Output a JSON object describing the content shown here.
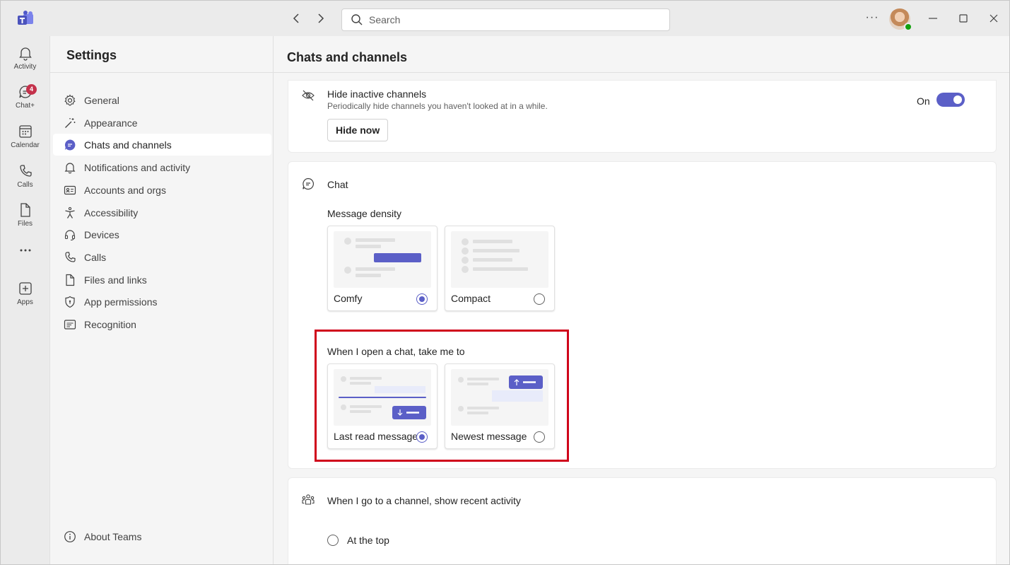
{
  "titlebar": {
    "search_placeholder": "Search",
    "more_label": "···"
  },
  "rail": {
    "items": [
      {
        "label": "Activity",
        "icon": "bell-icon"
      },
      {
        "label": "Chat+",
        "icon": "chat-icon",
        "badge": "4"
      },
      {
        "label": "Calendar",
        "icon": "calendar-icon"
      },
      {
        "label": "Calls",
        "icon": "phone-icon"
      },
      {
        "label": "Files",
        "icon": "file-icon"
      },
      {
        "label": "...",
        "icon": "more-icon"
      },
      {
        "label": "Apps",
        "icon": "add-app-icon"
      }
    ]
  },
  "settings": {
    "title": "Settings",
    "nav": [
      {
        "label": "General",
        "icon": "gear-icon"
      },
      {
        "label": "Appearance",
        "icon": "magic-wand-icon"
      },
      {
        "label": "Chats and channels",
        "icon": "chat-bubble-icon",
        "active": true
      },
      {
        "label": "Notifications and activity",
        "icon": "bell-icon"
      },
      {
        "label": "Accounts and orgs",
        "icon": "contact-card-icon"
      },
      {
        "label": "Accessibility",
        "icon": "accessibility-icon"
      },
      {
        "label": "Devices",
        "icon": "headset-icon"
      },
      {
        "label": "Calls",
        "icon": "phone-icon"
      },
      {
        "label": "Files and links",
        "icon": "document-icon"
      },
      {
        "label": "App permissions",
        "icon": "shield-icon"
      },
      {
        "label": "Recognition",
        "icon": "text-box-icon"
      }
    ],
    "about_label": "About Teams"
  },
  "main": {
    "title": "Chats and channels",
    "hide_inactive": {
      "title": "Hide inactive channels",
      "subtitle": "Periodically hide channels you haven't looked at in a while.",
      "button_label": "Hide now",
      "toggle_label": "On",
      "toggle_on": true
    },
    "chat": {
      "title": "Chat",
      "density_label": "Message density",
      "density_options": [
        {
          "label": "Comfy",
          "selected": true
        },
        {
          "label": "Compact",
          "selected": false
        }
      ],
      "open_chat_label": "When I open a chat, take me to",
      "open_chat_options": [
        {
          "label": "Last read message",
          "selected": true
        },
        {
          "label": "Newest message",
          "selected": false
        }
      ]
    },
    "channel": {
      "title": "When I go to a channel, show recent activity",
      "options": [
        {
          "label": "At the top",
          "selected": false
        }
      ]
    }
  },
  "colors": {
    "accent": "#5b5fc7",
    "highlight": "#d0021b",
    "badge": "#c4314b",
    "presence": "#13a10e"
  }
}
